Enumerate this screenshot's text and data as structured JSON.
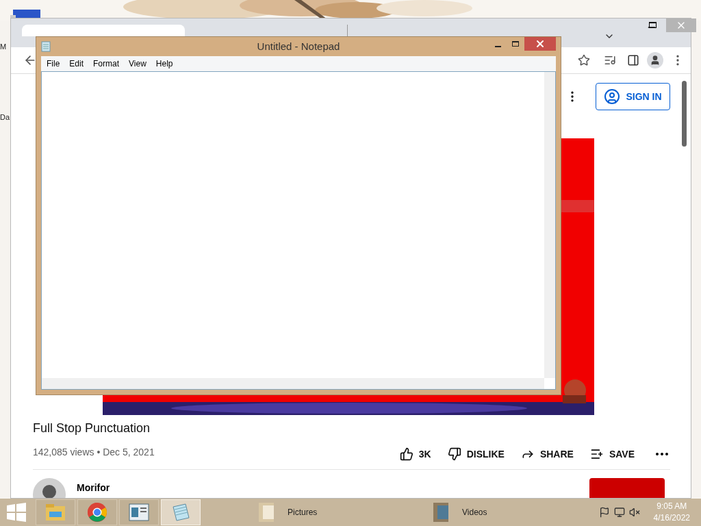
{
  "desktop": {
    "icons": [
      {
        "label": "M"
      },
      {
        "label": "Da"
      }
    ]
  },
  "browser": {
    "tabs": [
      {
        "selected": true
      },
      {
        "selected": false
      }
    ],
    "page": {
      "sign_in": "SIGN IN",
      "video_title": "Full Stop Punctuation",
      "meta": "142,085 views • Dec 5, 2021",
      "actions": [
        {
          "kind": "like",
          "label": "3K"
        },
        {
          "kind": "dislike",
          "label": "DISLIKE"
        },
        {
          "kind": "share",
          "label": "SHARE"
        },
        {
          "kind": "save",
          "label": "SAVE"
        }
      ],
      "channel": "Morifor"
    }
  },
  "notepad": {
    "title": "Untitled - Notepad",
    "menu": [
      "File",
      "Edit",
      "Format",
      "View",
      "Help"
    ]
  },
  "taskbar": {
    "apps": [
      {
        "kind": "explorer",
        "selected": false
      },
      {
        "kind": "chrome",
        "selected": false
      },
      {
        "kind": "viewer",
        "selected": false
      },
      {
        "kind": "notepad",
        "selected": true
      }
    ],
    "toolbar_items": [
      {
        "kind": "pictures",
        "label": "Pictures"
      },
      {
        "kind": "videos",
        "label": "Videos"
      }
    ],
    "time": "9:05 AM",
    "date": "4/16/2022"
  }
}
